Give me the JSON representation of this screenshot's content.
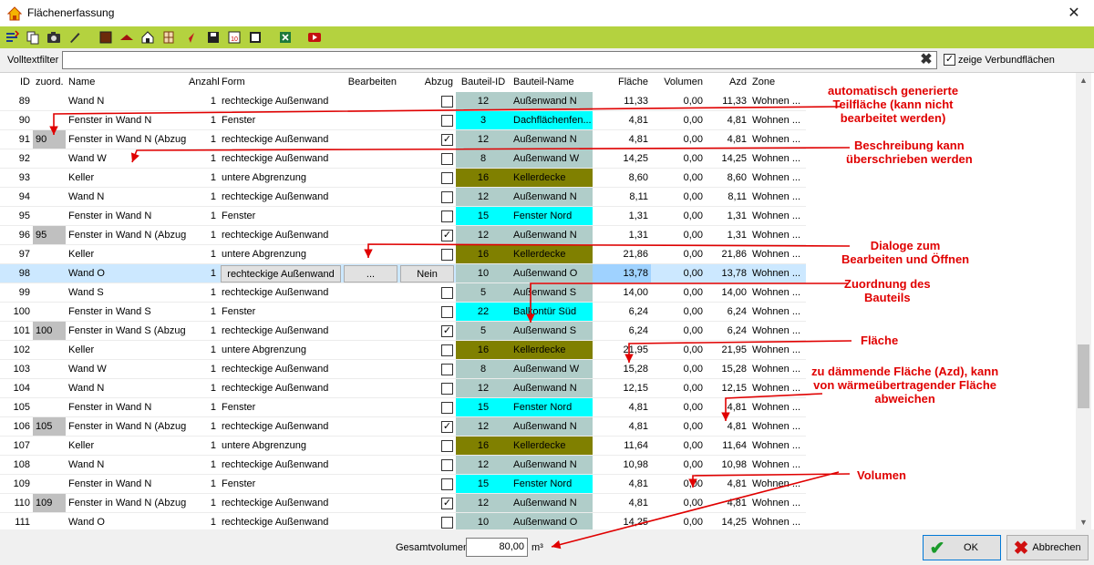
{
  "window": {
    "title": "Flächenerfassung",
    "close_glyph": "✕"
  },
  "toolbar": {
    "icons": [
      "sort-icon",
      "copy-icon",
      "camera-icon",
      "pen-icon",
      "wall-icon",
      "roof-icon",
      "house-icon",
      "window-icon",
      "pointer-icon",
      "save-icon",
      "calendar-icon",
      "frame-icon",
      "excel-icon",
      "video-icon"
    ]
  },
  "filter": {
    "label": "Volltextfilter",
    "value": "",
    "placeholder": "",
    "clear_glyph": "✖",
    "verbund_label": "zeige Verbundflächen",
    "verbund_checked": true
  },
  "grid": {
    "headers": {
      "id": "ID",
      "zuord": "zuord.",
      "name": "Name",
      "anzahl": "Anzahl",
      "form": "Form",
      "bearbeiten": "Bearbeiten",
      "abzug": "Abzug",
      "bauteil_id": "Bauteil-ID",
      "bauteil_name": "Bauteil-Name",
      "flaeche": "Fläche",
      "volumen": "Volumen",
      "azd": "Azd",
      "zone": "Zone"
    },
    "colors": {
      "aussenwand": "#b0cdc9",
      "fenster": "#00ffff",
      "kellerdecke": "#808000",
      "selected": "#cce8ff"
    },
    "rows": [
      {
        "id": "89",
        "zuord": "",
        "name": "Wand N",
        "anzahl": "1",
        "form": "rechteckige Außenwand",
        "abzug": false,
        "bauteil_id": "12",
        "bauteil_name": "Außenwand N",
        "flaeche": "11,33",
        "volumen": "0,00",
        "azd": "11,33",
        "zone": "Wohnen ...",
        "color": "aussenwand"
      },
      {
        "id": "90",
        "zuord": "",
        "name": "Fenster in Wand N",
        "anzahl": "1",
        "form": "Fenster",
        "abzug": false,
        "bauteil_id": "3",
        "bauteil_name": "Dachflächenfen...",
        "flaeche": "4,81",
        "volumen": "0,00",
        "azd": "4,81",
        "zone": "Wohnen ...",
        "color": "fenster"
      },
      {
        "id": "91",
        "zuord": "90",
        "name": "Fenster in Wand N (Abzug)",
        "anzahl": "1",
        "form": "rechteckige Außenwand",
        "abzug": true,
        "bauteil_id": "12",
        "bauteil_name": "Außenwand N",
        "flaeche": "4,81",
        "volumen": "0,00",
        "azd": "4,81",
        "zone": "Wohnen ...",
        "color": "aussenwand"
      },
      {
        "id": "92",
        "zuord": "",
        "name": "Wand W",
        "anzahl": "1",
        "form": "rechteckige Außenwand",
        "abzug": false,
        "bauteil_id": "8",
        "bauteil_name": "Außenwand W",
        "flaeche": "14,25",
        "volumen": "0,00",
        "azd": "14,25",
        "zone": "Wohnen ...",
        "color": "aussenwand"
      },
      {
        "id": "93",
        "zuord": "",
        "name": "Keller",
        "anzahl": "1",
        "form": "untere Abgrenzung",
        "abzug": false,
        "bauteil_id": "16",
        "bauteil_name": "Kellerdecke",
        "flaeche": "8,60",
        "volumen": "0,00",
        "azd": "8,60",
        "zone": "Wohnen ...",
        "color": "kellerdecke"
      },
      {
        "id": "94",
        "zuord": "",
        "name": "Wand N",
        "anzahl": "1",
        "form": "rechteckige Außenwand",
        "abzug": false,
        "bauteil_id": "12",
        "bauteil_name": "Außenwand N",
        "flaeche": "8,11",
        "volumen": "0,00",
        "azd": "8,11",
        "zone": "Wohnen ...",
        "color": "aussenwand"
      },
      {
        "id": "95",
        "zuord": "",
        "name": "Fenster in Wand N",
        "anzahl": "1",
        "form": "Fenster",
        "abzug": false,
        "bauteil_id": "15",
        "bauteil_name": "Fenster Nord",
        "flaeche": "1,31",
        "volumen": "0,00",
        "azd": "1,31",
        "zone": "Wohnen ...",
        "color": "fenster"
      },
      {
        "id": "96",
        "zuord": "95",
        "name": "Fenster in Wand N (Abzug)",
        "anzahl": "1",
        "form": "rechteckige Außenwand",
        "abzug": true,
        "bauteil_id": "12",
        "bauteil_name": "Außenwand N",
        "flaeche": "1,31",
        "volumen": "0,00",
        "azd": "1,31",
        "zone": "Wohnen ...",
        "color": "aussenwand"
      },
      {
        "id": "97",
        "zuord": "",
        "name": "Keller",
        "anzahl": "1",
        "form": "untere Abgrenzung",
        "abzug": false,
        "bauteil_id": "16",
        "bauteil_name": "Kellerdecke",
        "flaeche": "21,86",
        "volumen": "0,00",
        "azd": "21,86",
        "zone": "Wohnen ...",
        "color": "kellerdecke"
      },
      {
        "id": "98",
        "zuord": "",
        "name": "Wand O",
        "anzahl": "1",
        "form": "rechteckige Außenwand",
        "abzug": false,
        "abzug_text": "Nein",
        "bearbeiten": "...",
        "selected": true,
        "bauteil_id": "10",
        "bauteil_name": "Außenwand O",
        "flaeche": "13,78",
        "volumen": "0,00",
        "azd": "13,78",
        "zone": "Wohnen ...",
        "color": "aussenwand"
      },
      {
        "id": "99",
        "zuord": "",
        "name": "Wand S",
        "anzahl": "1",
        "form": "rechteckige Außenwand",
        "abzug": false,
        "bauteil_id": "5",
        "bauteil_name": "Außenwand S",
        "flaeche": "14,00",
        "volumen": "0,00",
        "azd": "14,00",
        "zone": "Wohnen ...",
        "color": "aussenwand"
      },
      {
        "id": "100",
        "zuord": "",
        "name": "Fenster in Wand S",
        "anzahl": "1",
        "form": "Fenster",
        "abzug": false,
        "bauteil_id": "22",
        "bauteil_name": "Balkontür Süd",
        "flaeche": "6,24",
        "volumen": "0,00",
        "azd": "6,24",
        "zone": "Wohnen ...",
        "color": "fenster"
      },
      {
        "id": "101",
        "zuord": "100",
        "name": "Fenster in Wand S (Abzug)",
        "anzahl": "1",
        "form": "rechteckige Außenwand",
        "abzug": true,
        "bauteil_id": "5",
        "bauteil_name": "Außenwand S",
        "flaeche": "6,24",
        "volumen": "0,00",
        "azd": "6,24",
        "zone": "Wohnen ...",
        "color": "aussenwand"
      },
      {
        "id": "102",
        "zuord": "",
        "name": "Keller",
        "anzahl": "1",
        "form": "untere Abgrenzung",
        "abzug": false,
        "bauteil_id": "16",
        "bauteil_name": "Kellerdecke",
        "flaeche": "21,95",
        "volumen": "0,00",
        "azd": "21,95",
        "zone": "Wohnen ...",
        "color": "kellerdecke"
      },
      {
        "id": "103",
        "zuord": "",
        "name": "Wand W",
        "anzahl": "1",
        "form": "rechteckige Außenwand",
        "abzug": false,
        "bauteil_id": "8",
        "bauteil_name": "Außenwand W",
        "flaeche": "15,28",
        "volumen": "0,00",
        "azd": "15,28",
        "zone": "Wohnen ...",
        "color": "aussenwand"
      },
      {
        "id": "104",
        "zuord": "",
        "name": "Wand N",
        "anzahl": "1",
        "form": "rechteckige Außenwand",
        "abzug": false,
        "bauteil_id": "12",
        "bauteil_name": "Außenwand N",
        "flaeche": "12,15",
        "volumen": "0,00",
        "azd": "12,15",
        "zone": "Wohnen ...",
        "color": "aussenwand"
      },
      {
        "id": "105",
        "zuord": "",
        "name": "Fenster in Wand N",
        "anzahl": "1",
        "form": "Fenster",
        "abzug": false,
        "bauteil_id": "15",
        "bauteil_name": "Fenster Nord",
        "flaeche": "4,81",
        "volumen": "0,00",
        "azd": "4,81",
        "zone": "Wohnen ...",
        "color": "fenster"
      },
      {
        "id": "106",
        "zuord": "105",
        "name": "Fenster in Wand N (Abzug)",
        "anzahl": "1",
        "form": "rechteckige Außenwand",
        "abzug": true,
        "bauteil_id": "12",
        "bauteil_name": "Außenwand N",
        "flaeche": "4,81",
        "volumen": "0,00",
        "azd": "4,81",
        "zone": "Wohnen ...",
        "color": "aussenwand"
      },
      {
        "id": "107",
        "zuord": "",
        "name": "Keller",
        "anzahl": "1",
        "form": "untere Abgrenzung",
        "abzug": false,
        "bauteil_id": "16",
        "bauteil_name": "Kellerdecke",
        "flaeche": "11,64",
        "volumen": "0,00",
        "azd": "11,64",
        "zone": "Wohnen ...",
        "color": "kellerdecke"
      },
      {
        "id": "108",
        "zuord": "",
        "name": "Wand N",
        "anzahl": "1",
        "form": "rechteckige Außenwand",
        "abzug": false,
        "bauteil_id": "12",
        "bauteil_name": "Außenwand N",
        "flaeche": "10,98",
        "volumen": "0,00",
        "azd": "10,98",
        "zone": "Wohnen ...",
        "color": "aussenwand"
      },
      {
        "id": "109",
        "zuord": "",
        "name": "Fenster in Wand N",
        "anzahl": "1",
        "form": "Fenster",
        "abzug": false,
        "bauteil_id": "15",
        "bauteil_name": "Fenster Nord",
        "flaeche": "4,81",
        "volumen": "0,00",
        "azd": "4,81",
        "zone": "Wohnen ...",
        "color": "fenster"
      },
      {
        "id": "110",
        "zuord": "109",
        "name": "Fenster in Wand N (Abzug)",
        "anzahl": "1",
        "form": "rechteckige Außenwand",
        "abzug": true,
        "bauteil_id": "12",
        "bauteil_name": "Außenwand N",
        "flaeche": "4,81",
        "volumen": "0,00",
        "azd": "4,81",
        "zone": "Wohnen ...",
        "color": "aussenwand"
      },
      {
        "id": "111",
        "zuord": "",
        "name": "Wand O",
        "anzahl": "1",
        "form": "rechteckige Außenwand",
        "abzug": false,
        "bauteil_id": "10",
        "bauteil_name": "Außenwand O",
        "flaeche": "14,25",
        "volumen": "0,00",
        "azd": "14,25",
        "zone": "Wohnen ...",
        "color": "aussenwand"
      }
    ]
  },
  "footer": {
    "gesamtvolumen_label": "Gesamtvolumen",
    "gesamtvolumen_value": "80,00",
    "unit": "m³",
    "ok_label": "OK",
    "cancel_label": "Abbrechen"
  },
  "annotations": {
    "auto": "automatisch generierte\nTeilfläche (kann nicht\nbearbeitet werden)",
    "beschreibung": "Beschreibung kann\nüberschrieben werden",
    "dialoge": "Dialoge zum\nBearbeiten und Öffnen",
    "zuordnung": "Zuordnung des\nBauteils",
    "flaeche": "Fläche",
    "azd": "zu dämmende Fläche (Azd), kann\nvon wärmeübertragender Fläche\nabweichen",
    "volumen": "Volumen"
  }
}
